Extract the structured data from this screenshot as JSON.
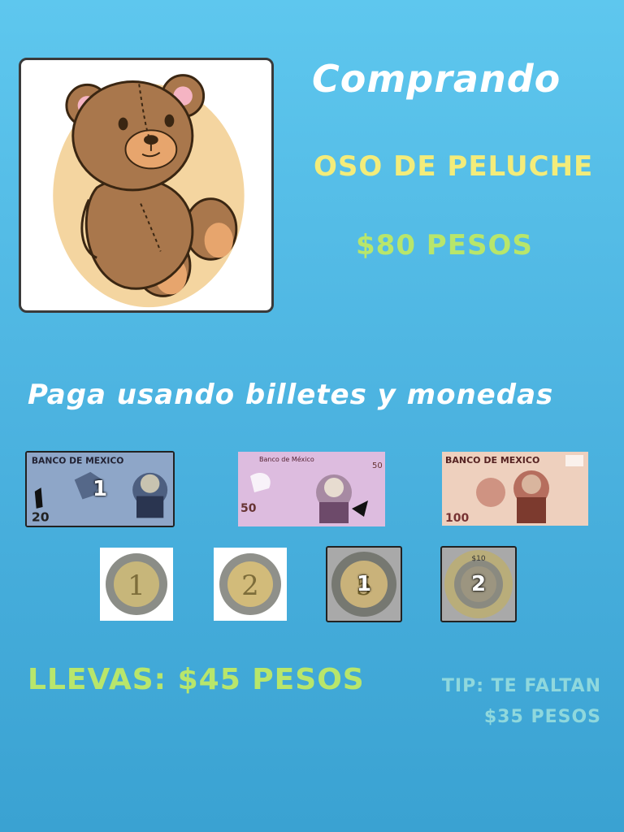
{
  "header": {
    "title": "Comprando",
    "product_name": "OSO DE PELUCHE",
    "product_price": "$80 PESOS"
  },
  "product": {
    "image_icon": "teddy-bear-icon"
  },
  "instructions": "Paga usando billetes y monedas",
  "bills": [
    {
      "denomination": "20",
      "count_label": "1",
      "selected": true
    },
    {
      "denomination": "50",
      "count_label": "",
      "selected": false
    },
    {
      "denomination": "100",
      "count_label": "",
      "selected": false
    }
  ],
  "coins": [
    {
      "denomination": "1",
      "count_label": "",
      "selected": false
    },
    {
      "denomination": "2",
      "count_label": "",
      "selected": false
    },
    {
      "denomination": "5",
      "count_label": "1",
      "selected": true
    },
    {
      "denomination": "10",
      "count_label": "2",
      "selected": true
    }
  ],
  "status": {
    "carrying": "LLEVAS: $45 PESOS",
    "tip_line1": "TIP: TE FALTAN",
    "tip_line2": "$35 PESOS"
  },
  "colors": {
    "background": "#4cb3e0",
    "title": "#ffffff",
    "product_name": "#f3ec7a",
    "price": "#b8e66b",
    "tip": "#8fd8dd"
  }
}
